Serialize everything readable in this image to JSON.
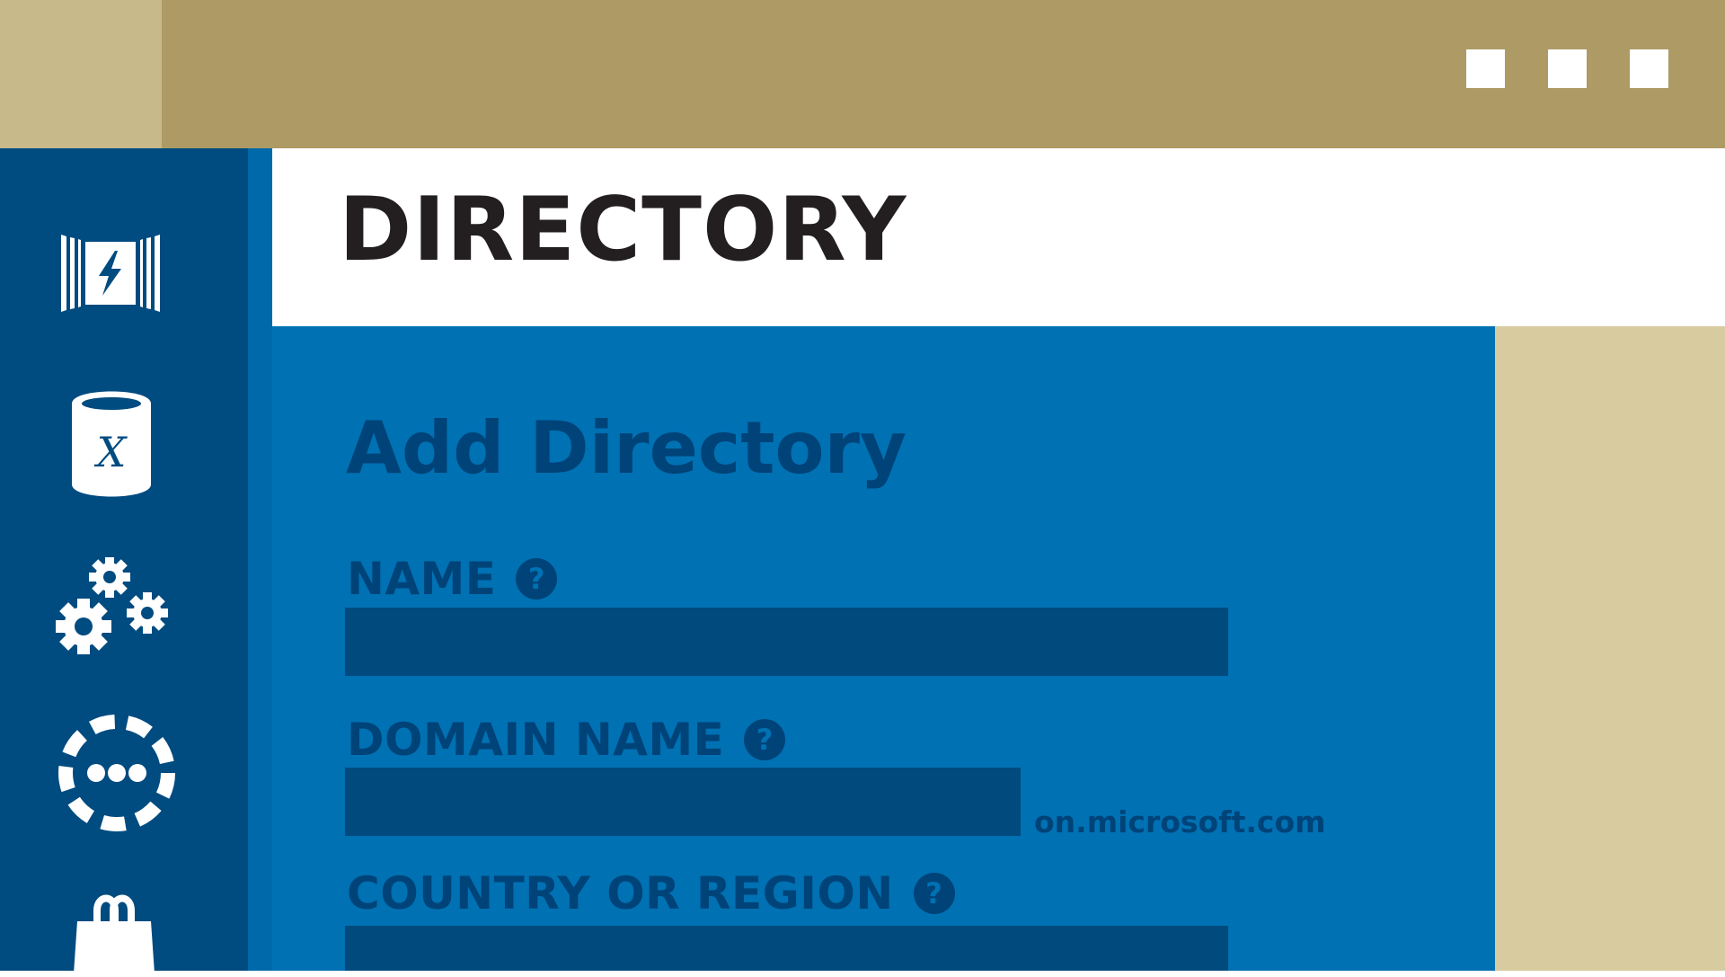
{
  "window": {
    "controls": [
      "window-button-1",
      "window-button-2",
      "window-button-3"
    ]
  },
  "sidebar": {
    "items": [
      {
        "name": "app-service-icon"
      },
      {
        "name": "sql-database-icon",
        "glyph": "X"
      },
      {
        "name": "gears-icon"
      },
      {
        "name": "more-services-icon"
      },
      {
        "name": "marketplace-bag-icon"
      }
    ]
  },
  "header": {
    "title": "DIRECTORY"
  },
  "form": {
    "title": "Add Directory",
    "fields": [
      {
        "label": "NAME",
        "help": "?",
        "value": ""
      },
      {
        "label": "DOMAIN NAME",
        "help": "?",
        "value": "",
        "suffix": "on.microsoft.com"
      },
      {
        "label": "COUNTRY OR REGION",
        "help": "?",
        "value": ""
      }
    ]
  },
  "colors": {
    "topbar": "#ae9a64",
    "topbar_left": "#c8b98b",
    "sidebar": "#004b80",
    "main_panel": "#0071b3",
    "input_fill": "#004a7d",
    "right_strip": "#d8cba0",
    "title_text": "#231f20"
  }
}
